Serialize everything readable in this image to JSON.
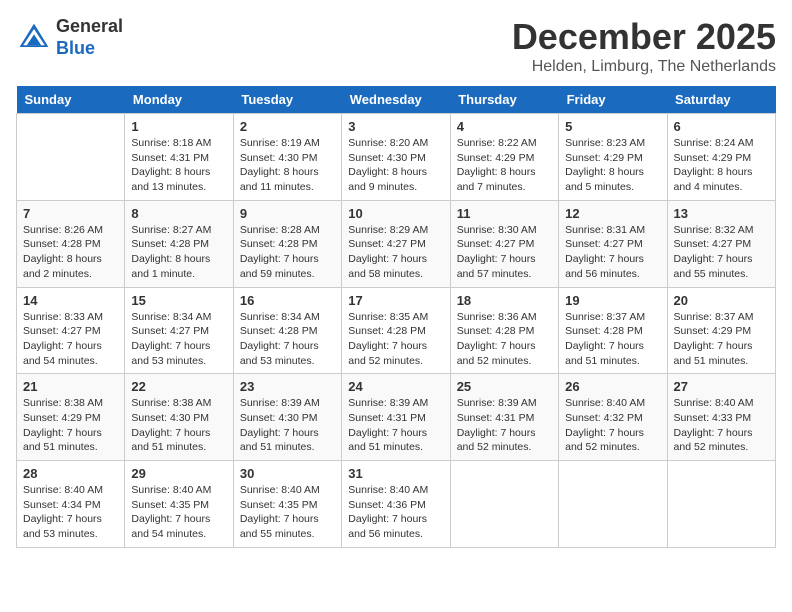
{
  "header": {
    "logo_general": "General",
    "logo_blue": "Blue",
    "month_title": "December 2025",
    "location": "Helden, Limburg, The Netherlands"
  },
  "calendar": {
    "days_of_week": [
      "Sunday",
      "Monday",
      "Tuesday",
      "Wednesday",
      "Thursday",
      "Friday",
      "Saturday"
    ],
    "weeks": [
      [
        {
          "day": "",
          "sunrise": "",
          "sunset": "",
          "daylight": ""
        },
        {
          "day": "1",
          "sunrise": "Sunrise: 8:18 AM",
          "sunset": "Sunset: 4:31 PM",
          "daylight": "Daylight: 8 hours and 13 minutes."
        },
        {
          "day": "2",
          "sunrise": "Sunrise: 8:19 AM",
          "sunset": "Sunset: 4:30 PM",
          "daylight": "Daylight: 8 hours and 11 minutes."
        },
        {
          "day": "3",
          "sunrise": "Sunrise: 8:20 AM",
          "sunset": "Sunset: 4:30 PM",
          "daylight": "Daylight: 8 hours and 9 minutes."
        },
        {
          "day": "4",
          "sunrise": "Sunrise: 8:22 AM",
          "sunset": "Sunset: 4:29 PM",
          "daylight": "Daylight: 8 hours and 7 minutes."
        },
        {
          "day": "5",
          "sunrise": "Sunrise: 8:23 AM",
          "sunset": "Sunset: 4:29 PM",
          "daylight": "Daylight: 8 hours and 5 minutes."
        },
        {
          "day": "6",
          "sunrise": "Sunrise: 8:24 AM",
          "sunset": "Sunset: 4:29 PM",
          "daylight": "Daylight: 8 hours and 4 minutes."
        }
      ],
      [
        {
          "day": "7",
          "sunrise": "Sunrise: 8:26 AM",
          "sunset": "Sunset: 4:28 PM",
          "daylight": "Daylight: 8 hours and 2 minutes."
        },
        {
          "day": "8",
          "sunrise": "Sunrise: 8:27 AM",
          "sunset": "Sunset: 4:28 PM",
          "daylight": "Daylight: 8 hours and 1 minute."
        },
        {
          "day": "9",
          "sunrise": "Sunrise: 8:28 AM",
          "sunset": "Sunset: 4:28 PM",
          "daylight": "Daylight: 7 hours and 59 minutes."
        },
        {
          "day": "10",
          "sunrise": "Sunrise: 8:29 AM",
          "sunset": "Sunset: 4:27 PM",
          "daylight": "Daylight: 7 hours and 58 minutes."
        },
        {
          "day": "11",
          "sunrise": "Sunrise: 8:30 AM",
          "sunset": "Sunset: 4:27 PM",
          "daylight": "Daylight: 7 hours and 57 minutes."
        },
        {
          "day": "12",
          "sunrise": "Sunrise: 8:31 AM",
          "sunset": "Sunset: 4:27 PM",
          "daylight": "Daylight: 7 hours and 56 minutes."
        },
        {
          "day": "13",
          "sunrise": "Sunrise: 8:32 AM",
          "sunset": "Sunset: 4:27 PM",
          "daylight": "Daylight: 7 hours and 55 minutes."
        }
      ],
      [
        {
          "day": "14",
          "sunrise": "Sunrise: 8:33 AM",
          "sunset": "Sunset: 4:27 PM",
          "daylight": "Daylight: 7 hours and 54 minutes."
        },
        {
          "day": "15",
          "sunrise": "Sunrise: 8:34 AM",
          "sunset": "Sunset: 4:27 PM",
          "daylight": "Daylight: 7 hours and 53 minutes."
        },
        {
          "day": "16",
          "sunrise": "Sunrise: 8:34 AM",
          "sunset": "Sunset: 4:28 PM",
          "daylight": "Daylight: 7 hours and 53 minutes."
        },
        {
          "day": "17",
          "sunrise": "Sunrise: 8:35 AM",
          "sunset": "Sunset: 4:28 PM",
          "daylight": "Daylight: 7 hours and 52 minutes."
        },
        {
          "day": "18",
          "sunrise": "Sunrise: 8:36 AM",
          "sunset": "Sunset: 4:28 PM",
          "daylight": "Daylight: 7 hours and 52 minutes."
        },
        {
          "day": "19",
          "sunrise": "Sunrise: 8:37 AM",
          "sunset": "Sunset: 4:28 PM",
          "daylight": "Daylight: 7 hours and 51 minutes."
        },
        {
          "day": "20",
          "sunrise": "Sunrise: 8:37 AM",
          "sunset": "Sunset: 4:29 PM",
          "daylight": "Daylight: 7 hours and 51 minutes."
        }
      ],
      [
        {
          "day": "21",
          "sunrise": "Sunrise: 8:38 AM",
          "sunset": "Sunset: 4:29 PM",
          "daylight": "Daylight: 7 hours and 51 minutes."
        },
        {
          "day": "22",
          "sunrise": "Sunrise: 8:38 AM",
          "sunset": "Sunset: 4:30 PM",
          "daylight": "Daylight: 7 hours and 51 minutes."
        },
        {
          "day": "23",
          "sunrise": "Sunrise: 8:39 AM",
          "sunset": "Sunset: 4:30 PM",
          "daylight": "Daylight: 7 hours and 51 minutes."
        },
        {
          "day": "24",
          "sunrise": "Sunrise: 8:39 AM",
          "sunset": "Sunset: 4:31 PM",
          "daylight": "Daylight: 7 hours and 51 minutes."
        },
        {
          "day": "25",
          "sunrise": "Sunrise: 8:39 AM",
          "sunset": "Sunset: 4:31 PM",
          "daylight": "Daylight: 7 hours and 52 minutes."
        },
        {
          "day": "26",
          "sunrise": "Sunrise: 8:40 AM",
          "sunset": "Sunset: 4:32 PM",
          "daylight": "Daylight: 7 hours and 52 minutes."
        },
        {
          "day": "27",
          "sunrise": "Sunrise: 8:40 AM",
          "sunset": "Sunset: 4:33 PM",
          "daylight": "Daylight: 7 hours and 52 minutes."
        }
      ],
      [
        {
          "day": "28",
          "sunrise": "Sunrise: 8:40 AM",
          "sunset": "Sunset: 4:34 PM",
          "daylight": "Daylight: 7 hours and 53 minutes."
        },
        {
          "day": "29",
          "sunrise": "Sunrise: 8:40 AM",
          "sunset": "Sunset: 4:35 PM",
          "daylight": "Daylight: 7 hours and 54 minutes."
        },
        {
          "day": "30",
          "sunrise": "Sunrise: 8:40 AM",
          "sunset": "Sunset: 4:35 PM",
          "daylight": "Daylight: 7 hours and 55 minutes."
        },
        {
          "day": "31",
          "sunrise": "Sunrise: 8:40 AM",
          "sunset": "Sunset: 4:36 PM",
          "daylight": "Daylight: 7 hours and 56 minutes."
        },
        {
          "day": "",
          "sunrise": "",
          "sunset": "",
          "daylight": ""
        },
        {
          "day": "",
          "sunrise": "",
          "sunset": "",
          "daylight": ""
        },
        {
          "day": "",
          "sunrise": "",
          "sunset": "",
          "daylight": ""
        }
      ]
    ]
  }
}
